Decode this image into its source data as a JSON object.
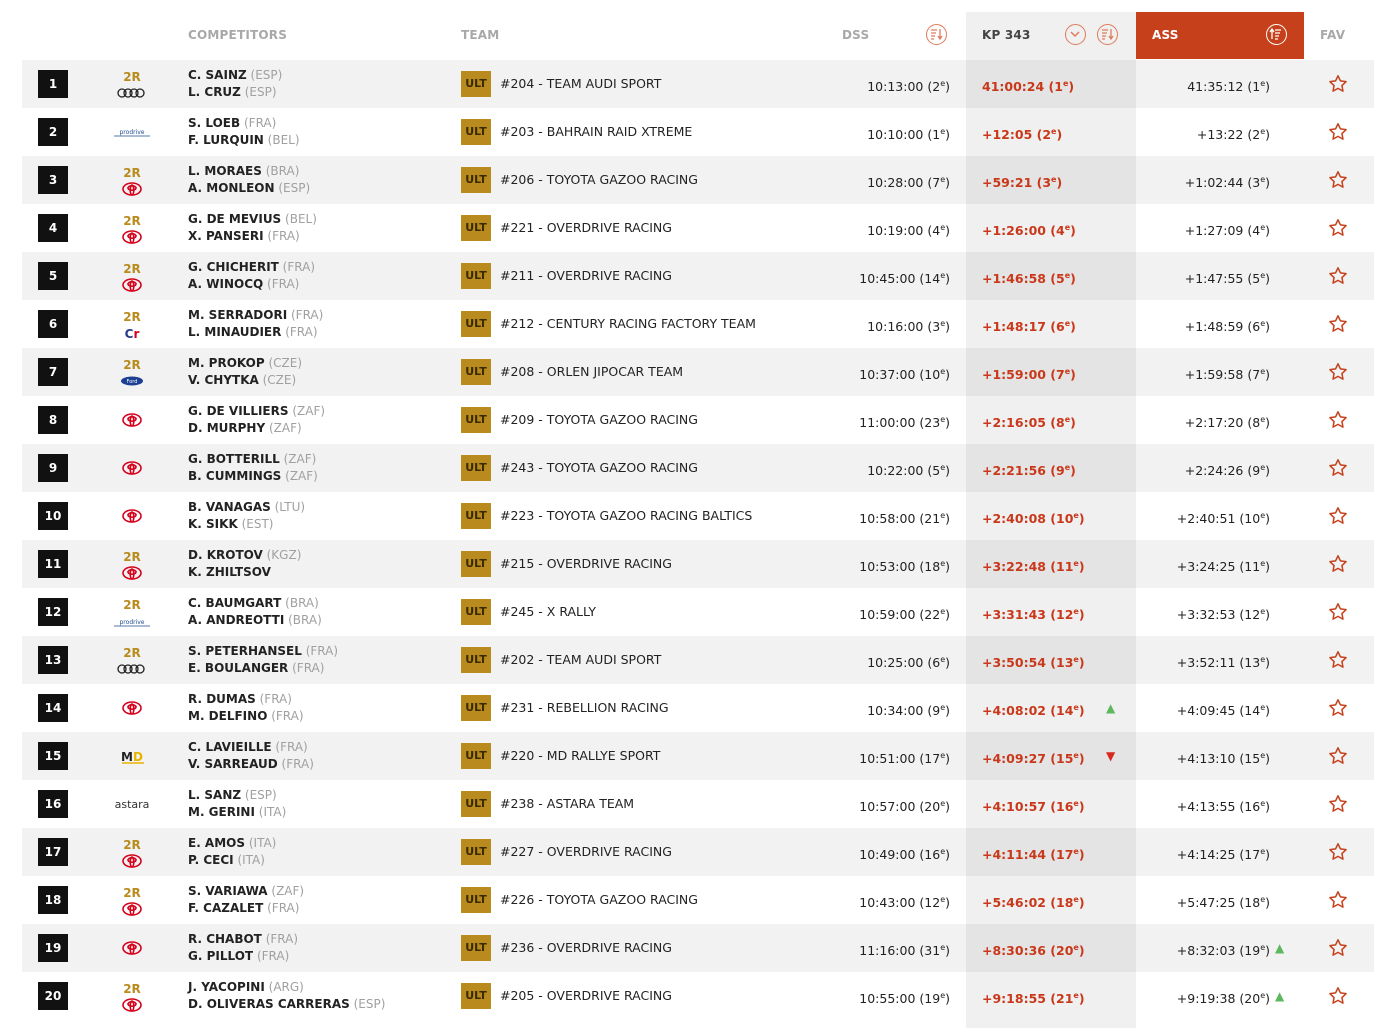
{
  "header": {
    "competitors": "COMPETITORS",
    "team": "TEAM",
    "dss": "DSS",
    "kp": "KP 343",
    "ass": "ASS",
    "fav": "FAV"
  },
  "colors": {
    "accent": "#c5401b",
    "category": "#b98a1e",
    "gain": "#5cb85c",
    "loss": "#d9281e"
  },
  "rows": [
    {
      "pos": "1",
      "logo": "2r-audi",
      "d1": "C. SAINZ",
      "c1": "(ESP)",
      "d2": "L. CRUZ",
      "c2": "(ESP)",
      "cat": "ULT",
      "team": "#204 - TEAM AUDI SPORT",
      "dss": "10:13:00 (2",
      "dss_r": "e",
      ")": "",
      "kp": "41:00:24 (1",
      "kp_r": "e",
      "ass": "41:35:12 (1",
      "ass_r": "e",
      "trend": ""
    },
    {
      "pos": "2",
      "logo": "prodrive",
      "d1": "S. LOEB",
      "c1": "(FRA)",
      "d2": "F. LURQUIN",
      "c2": "(BEL)",
      "cat": "ULT",
      "team": "#203 - BAHRAIN RAID XTREME",
      "dss": "10:10:00 (1",
      "dss_r": "e",
      "kp": "+12:05 (2",
      "kp_r": "e",
      "ass": "+13:22 (2",
      "ass_r": "e",
      "trend": ""
    },
    {
      "pos": "3",
      "logo": "2r-toyota",
      "d1": "L. MORAES",
      "c1": "(BRA)",
      "d2": "A. MONLEON",
      "c2": "(ESP)",
      "cat": "ULT",
      "team": "#206 - TOYOTA GAZOO RACING",
      "dss": "10:28:00 (7",
      "dss_r": "e",
      "kp": "+59:21 (3",
      "kp_r": "e",
      "ass": "+1:02:44 (3",
      "ass_r": "e",
      "trend": ""
    },
    {
      "pos": "4",
      "logo": "2r-toyota",
      "d1": "G. DE MEVIUS",
      "c1": "(BEL)",
      "d2": "X. PANSERI",
      "c2": "(FRA)",
      "cat": "ULT",
      "team": "#221 - OVERDRIVE RACING",
      "dss": "10:19:00 (4",
      "dss_r": "e",
      "kp": "+1:26:00 (4",
      "kp_r": "e",
      "ass": "+1:27:09 (4",
      "ass_r": "e",
      "trend": ""
    },
    {
      "pos": "5",
      "logo": "2r-toyota",
      "d1": "G. CHICHERIT",
      "c1": "(FRA)",
      "d2": "A. WINOCQ",
      "c2": "(FRA)",
      "cat": "ULT",
      "team": "#211 - OVERDRIVE RACING",
      "dss": "10:45:00 (14",
      "dss_r": "e",
      "kp": "+1:46:58 (5",
      "kp_r": "e",
      "ass": "+1:47:55 (5",
      "ass_r": "e",
      "trend": ""
    },
    {
      "pos": "6",
      "logo": "2r-century",
      "d1": "M. SERRADORI",
      "c1": "(FRA)",
      "d2": "L. MINAUDIER",
      "c2": "(FRA)",
      "cat": "ULT",
      "team": "#212 - CENTURY RACING FACTORY TEAM",
      "dss": "10:16:00 (3",
      "dss_r": "e",
      "kp": "+1:48:17 (6",
      "kp_r": "e",
      "ass": "+1:48:59 (6",
      "ass_r": "e",
      "trend": ""
    },
    {
      "pos": "7",
      "logo": "2r-ford",
      "d1": "M. PROKOP",
      "c1": "(CZE)",
      "d2": "V. CHYTKA",
      "c2": "(CZE)",
      "cat": "ULT",
      "team": "#208 - ORLEN JIPOCAR TEAM",
      "dss": "10:37:00 (10",
      "dss_r": "e",
      "kp": "+1:59:00 (7",
      "kp_r": "e",
      "ass": "+1:59:58 (7",
      "ass_r": "e",
      "trend": ""
    },
    {
      "pos": "8",
      "logo": "toyota",
      "d1": "G. DE VILLIERS",
      "c1": "(ZAF)",
      "d2": "D. MURPHY",
      "c2": "(ZAF)",
      "cat": "ULT",
      "team": "#209 - TOYOTA GAZOO RACING",
      "dss": "11:00:00 (23",
      "dss_r": "e",
      "kp": "+2:16:05 (8",
      "kp_r": "e",
      "ass": "+2:17:20 (8",
      "ass_r": "e",
      "trend": ""
    },
    {
      "pos": "9",
      "logo": "toyota",
      "d1": "G. BOTTERILL",
      "c1": "(ZAF)",
      "d2": "B. CUMMINGS",
      "c2": "(ZAF)",
      "cat": "ULT",
      "team": "#243 - TOYOTA GAZOO RACING",
      "dss": "10:22:00 (5",
      "dss_r": "e",
      "kp": "+2:21:56 (9",
      "kp_r": "e",
      "ass": "+2:24:26 (9",
      "ass_r": "e",
      "trend": ""
    },
    {
      "pos": "10",
      "logo": "toyota",
      "d1": "B. VANAGAS",
      "c1": "(LTU)",
      "d2": "K. SIKK",
      "c2": "(EST)",
      "cat": "ULT",
      "team": "#223 - TOYOTA GAZOO RACING BALTICS",
      "dss": "10:58:00 (21",
      "dss_r": "e",
      "kp": "+2:40:08 (10",
      "kp_r": "e",
      "ass": "+2:40:51 (10",
      "ass_r": "e",
      "trend": ""
    },
    {
      "pos": "11",
      "logo": "2r-toyota",
      "d1": "D. KROTOV",
      "c1": "(KGZ)",
      "d2": "K. ZHILTSOV",
      "c2": "",
      "cat": "ULT",
      "team": "#215 - OVERDRIVE RACING",
      "dss": "10:53:00 (18",
      "dss_r": "e",
      "kp": "+3:22:48 (11",
      "kp_r": "e",
      "ass": "+3:24:25 (11",
      "ass_r": "e",
      "trend": ""
    },
    {
      "pos": "12",
      "logo": "2r-prodrive",
      "d1": "C. BAUMGART",
      "c1": "(BRA)",
      "d2": "A. ANDREOTTI",
      "c2": "(BRA)",
      "cat": "ULT",
      "team": "#245 - X RALLY",
      "dss": "10:59:00 (22",
      "dss_r": "e",
      "kp": "+3:31:43 (12",
      "kp_r": "e",
      "ass": "+3:32:53 (12",
      "ass_r": "e",
      "trend": ""
    },
    {
      "pos": "13",
      "logo": "2r-audi",
      "d1": "S. PETERHANSEL",
      "c1": "(FRA)",
      "d2": "E. BOULANGER",
      "c2": "(FRA)",
      "cat": "ULT",
      "team": "#202 - TEAM AUDI SPORT",
      "dss": "10:25:00 (6",
      "dss_r": "e",
      "kp": "+3:50:54 (13",
      "kp_r": "e",
      "ass": "+3:52:11 (13",
      "ass_r": "e",
      "trend": ""
    },
    {
      "pos": "14",
      "logo": "toyota",
      "d1": "R. DUMAS",
      "c1": "(FRA)",
      "d2": "M. DELFINO",
      "c2": "(FRA)",
      "cat": "ULT",
      "team": "#231 - REBELLION RACING",
      "dss": "10:34:00 (9",
      "dss_r": "e",
      "kp": "+4:08:02 (14",
      "kp_r": "e",
      "ass": "+4:09:45 (14",
      "ass_r": "e",
      "trend": "kp-up"
    },
    {
      "pos": "15",
      "logo": "md",
      "d1": "C. LAVIEILLE",
      "c1": "(FRA)",
      "d2": "V. SARREAUD",
      "c2": "(FRA)",
      "cat": "ULT",
      "team": "#220 - MD RALLYE SPORT",
      "dss": "10:51:00 (17",
      "dss_r": "e",
      "kp": "+4:09:27 (15",
      "kp_r": "e",
      "ass": "+4:13:10 (15",
      "ass_r": "e",
      "trend": "kp-down"
    },
    {
      "pos": "16",
      "logo": "astara",
      "d1": "L. SANZ",
      "c1": "(ESP)",
      "d2": "M. GERINI",
      "c2": "(ITA)",
      "cat": "ULT",
      "team": "#238 - ASTARA TEAM",
      "dss": "10:57:00 (20",
      "dss_r": "e",
      "kp": "+4:10:57 (16",
      "kp_r": "e",
      "ass": "+4:13:55 (16",
      "ass_r": "e",
      "trend": ""
    },
    {
      "pos": "17",
      "logo": "2r-toyota",
      "d1": "E. AMOS",
      "c1": "(ITA)",
      "d2": "P. CECI",
      "c2": "(ITA)",
      "cat": "ULT",
      "team": "#227 - OVERDRIVE RACING",
      "dss": "10:49:00 (16",
      "dss_r": "e",
      "kp": "+4:11:44 (17",
      "kp_r": "e",
      "ass": "+4:14:25 (17",
      "ass_r": "e",
      "trend": ""
    },
    {
      "pos": "18",
      "logo": "2r-toyota",
      "d1": "S. VARIAWA",
      "c1": "(ZAF)",
      "d2": "F. CAZALET",
      "c2": "(FRA)",
      "cat": "ULT",
      "team": "#226 - TOYOTA GAZOO RACING",
      "dss": "10:43:00 (12",
      "dss_r": "e",
      "kp": "+5:46:02 (18",
      "kp_r": "e",
      "ass": "+5:47:25 (18",
      "ass_r": "e",
      "trend": ""
    },
    {
      "pos": "19",
      "logo": "toyota",
      "d1": "R. CHABOT",
      "c1": "(FRA)",
      "d2": "G. PILLOT",
      "c2": "(FRA)",
      "cat": "ULT",
      "team": "#236 - OVERDRIVE RACING",
      "dss": "11:16:00 (31",
      "dss_r": "e",
      "kp": "+8:30:36 (20",
      "kp_r": "e",
      "ass": "+8:32:03 (19",
      "ass_r": "e",
      "trend": "ass-up"
    },
    {
      "pos": "20",
      "logo": "2r-toyota",
      "d1": "J. YACOPINI",
      "c1": "(ARG)",
      "d2": "D. OLIVERAS CARRERAS",
      "c2": "(ESP)",
      "cat": "ULT",
      "team": "#205 - OVERDRIVE RACING",
      "dss": "10:55:00 (19",
      "dss_r": "e",
      "kp": "+9:18:55 (21",
      "kp_r": "e",
      "ass": "+9:19:38 (20",
      "ass_r": "e",
      "trend": "ass-up"
    }
  ]
}
